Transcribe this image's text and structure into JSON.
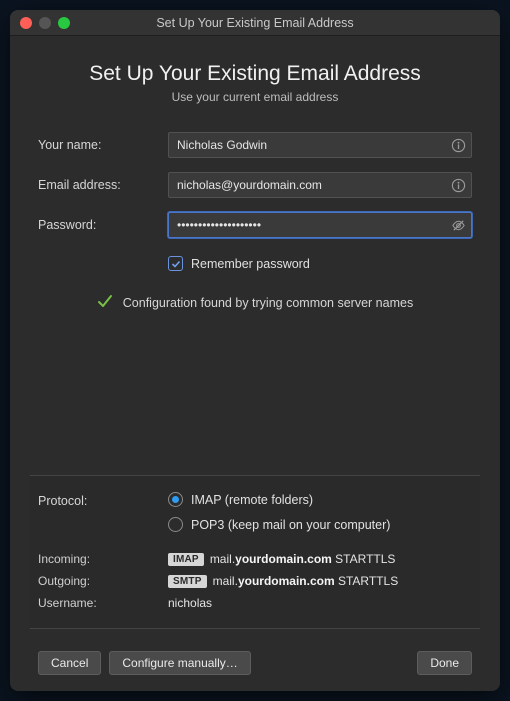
{
  "titlebar": {
    "title": "Set Up Your Existing Email Address"
  },
  "header": {
    "title": "Set Up Your Existing Email Address",
    "subtitle": "Use your current email address"
  },
  "form": {
    "name_label": "Your name:",
    "name_value": "Nicholas Godwin",
    "email_label": "Email address:",
    "email_value": "nicholas@yourdomain.com",
    "password_label": "Password:",
    "password_value": "••••••••••••••••••••",
    "remember_label": "Remember password",
    "remember_checked": true
  },
  "status": {
    "text": "Configuration found by trying common server names"
  },
  "protocol": {
    "label": "Protocol:",
    "options": [
      {
        "label": "IMAP (remote folders)",
        "checked": true
      },
      {
        "label": "POP3 (keep mail on your computer)",
        "checked": false
      }
    ]
  },
  "servers": {
    "incoming_label": "Incoming:",
    "incoming_badge": "IMAP",
    "incoming_prefix": "mail.",
    "incoming_bold": "yourdomain.com",
    "incoming_suffix": " STARTTLS",
    "outgoing_label": "Outgoing:",
    "outgoing_badge": "SMTP",
    "outgoing_prefix": "mail.",
    "outgoing_bold": "yourdomain.com",
    "outgoing_suffix": " STARTTLS",
    "username_label": "Username:",
    "username_value": "nicholas"
  },
  "buttons": {
    "cancel": "Cancel",
    "configure": "Configure manually…",
    "done": "Done"
  }
}
